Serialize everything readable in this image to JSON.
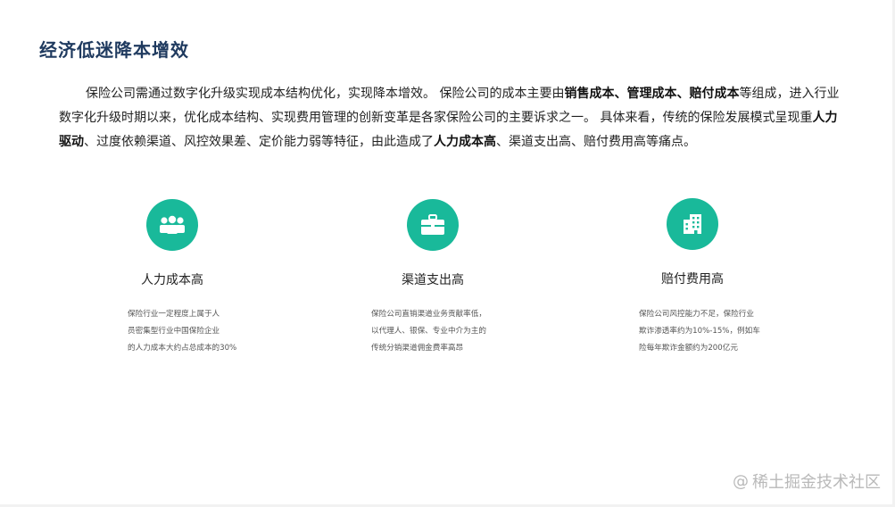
{
  "title": "经济低迷降本增效",
  "intro": {
    "segments": [
      {
        "text": "保险公司需通过数字化升级实现成本结构优化，实现降本增效。 保险公司的成本主要由",
        "bold": false
      },
      {
        "text": "销售成本、管理成本、赔付成本",
        "bold": true
      },
      {
        "text": "等组成，进入行业数字化升级时期以来，优化成本结构、实现费用管理的创新变革是各家保险公司的主要诉求之一。 具体来看，传统的保险发展模式呈现重",
        "bold": false
      },
      {
        "text": "人力驱动",
        "bold": true
      },
      {
        "text": "、过度依赖渠道、风控效果差、定价能力弱等特征，由此造成了",
        "bold": false
      },
      {
        "text": "人力成本高",
        "bold": true
      },
      {
        "text": "、渠道支出高、赔付费用高等痛点。",
        "bold": false
      }
    ]
  },
  "cards": [
    {
      "icon": "people-icon",
      "title": "人力成本高",
      "desc": [
        "保险行业一定程度上属于人",
        "员密集型行业中国保险企业",
        "的人力成本大约占总成本的30%"
      ]
    },
    {
      "icon": "briefcase-icon",
      "title": "渠道支出高",
      "desc": [
        "保险公司直销渠道业务贡献率低，",
        "以代理人、银保、专业中介为主的",
        "传统分销渠道佣金费率高昂"
      ]
    },
    {
      "icon": "building-icon",
      "title": "赔付费用高",
      "desc": [
        "保险公司风控能力不足，保险行业",
        "欺诈渗透率约为10%-15%，例如车",
        "险每年欺诈金额约为200亿元"
      ]
    }
  ],
  "watermark": {
    "at": "@",
    "text": "稀土掘金技术社区"
  },
  "colors": {
    "accent": "#19b99a",
    "title": "#1f3a5f",
    "text": "#222222",
    "desc": "#555555",
    "watermark": "#b9b9b9"
  }
}
